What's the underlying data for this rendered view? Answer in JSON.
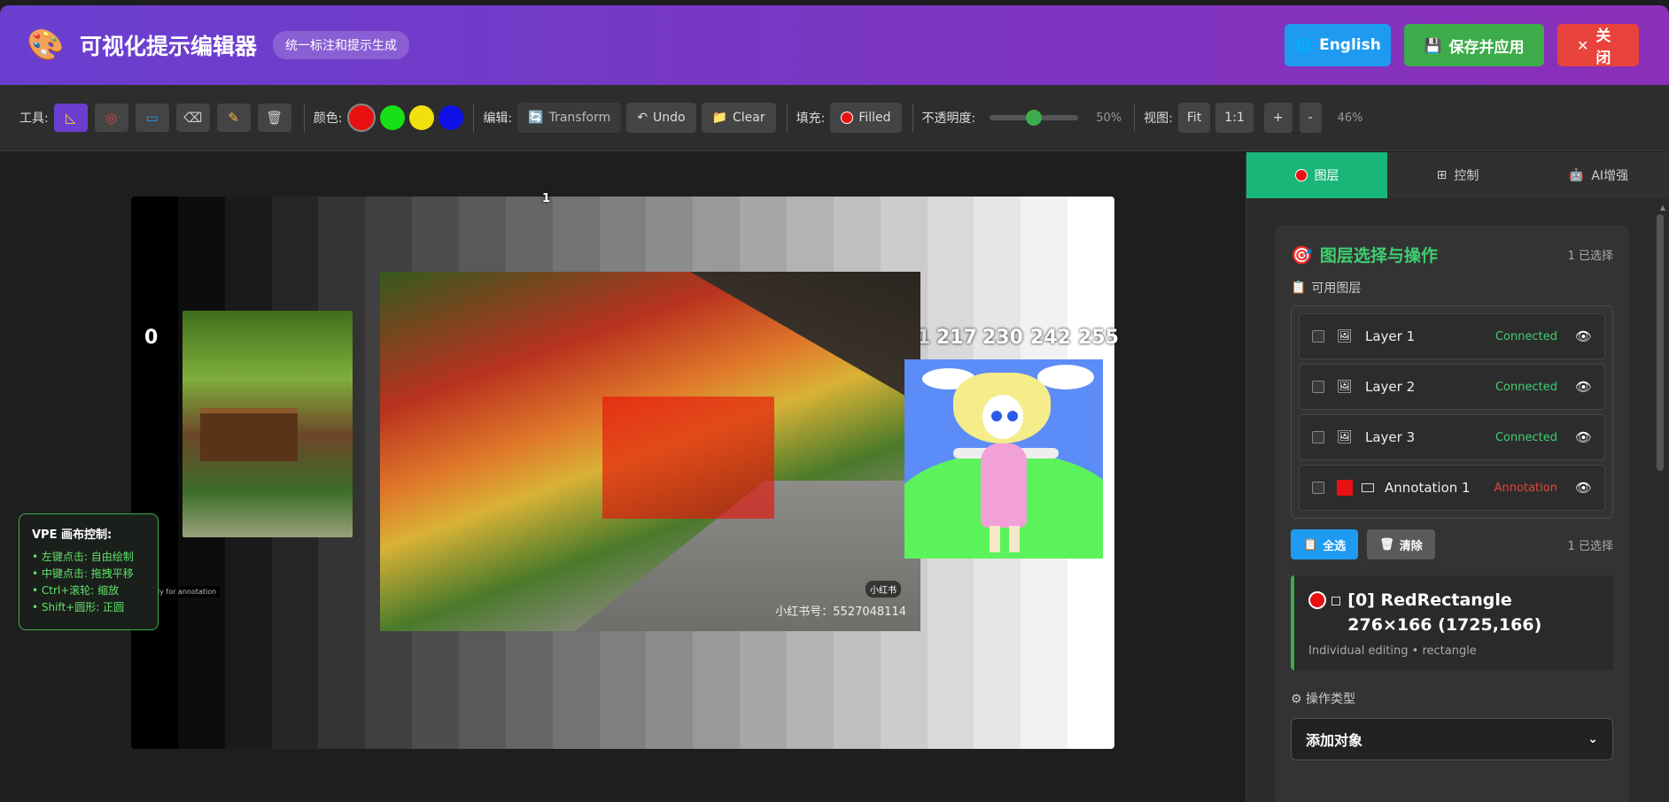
{
  "header": {
    "title": "可视化提示编辑器",
    "subtitle": "统一标注和提示生成",
    "english_label": "English",
    "save_label": "保存并应用",
    "close_label": "关闭"
  },
  "toolbar": {
    "tools_label": "工具:",
    "colors_label": "颜色:",
    "colors": [
      "#e81010",
      "#18e018",
      "#f0e010",
      "#1010e8"
    ],
    "edit_label": "编辑:",
    "transform_label": "Transform",
    "undo_label": "Undo",
    "clear_label": "Clear",
    "fill_label": "填充:",
    "filled_label": "Filled",
    "opacity_label": "不透明度:",
    "opacity_value": "50%",
    "opacity_fraction": 0.5,
    "view_label": "视图:",
    "fit_label": "Fit",
    "one_to_one_label": "1:1",
    "zoom_in_label": "+",
    "zoom_out_label": "-",
    "zoom_value": "46%"
  },
  "canvas": {
    "label_top": "1",
    "label_zero": "0",
    "label_217": "217",
    "label_230": "230",
    "label_242": "242",
    "label_255": "255",
    "partial_label": "1",
    "watermark": "小红书号：5527048114",
    "badge": "小红书",
    "ready_text": "Ready for annotation",
    "vpe_title": "VPE 画布控制:",
    "vpe_items": [
      "• 左键点击: 自由绘制",
      "• 中键点击: 拖拽平移",
      "• Ctrl+滚轮: 缩放",
      "• Shift+圆形: 正圆"
    ]
  },
  "panel": {
    "tabs": [
      {
        "label": "图层"
      },
      {
        "label": "控制"
      },
      {
        "label": "AI增强"
      }
    ],
    "section_title": "图层选择与操作",
    "selected_count": "1 已选择",
    "available_layers_label": "可用图层",
    "layers": [
      {
        "name": "Layer 1",
        "status": "Connected"
      },
      {
        "name": "Layer 2",
        "status": "Connected"
      },
      {
        "name": "Layer 3",
        "status": "Connected"
      },
      {
        "name": "Annotation 1",
        "status": "Annotation"
      }
    ],
    "select_all_label": "全选",
    "clear_label": "清除",
    "selected_count_2": "1 已选择",
    "object_title": "[0] RedRectangle 276×166 (1725,166)",
    "object_sub": "Individual editing • rectangle",
    "op_type_label": "操作类型",
    "op_type_value": "添加对象"
  }
}
